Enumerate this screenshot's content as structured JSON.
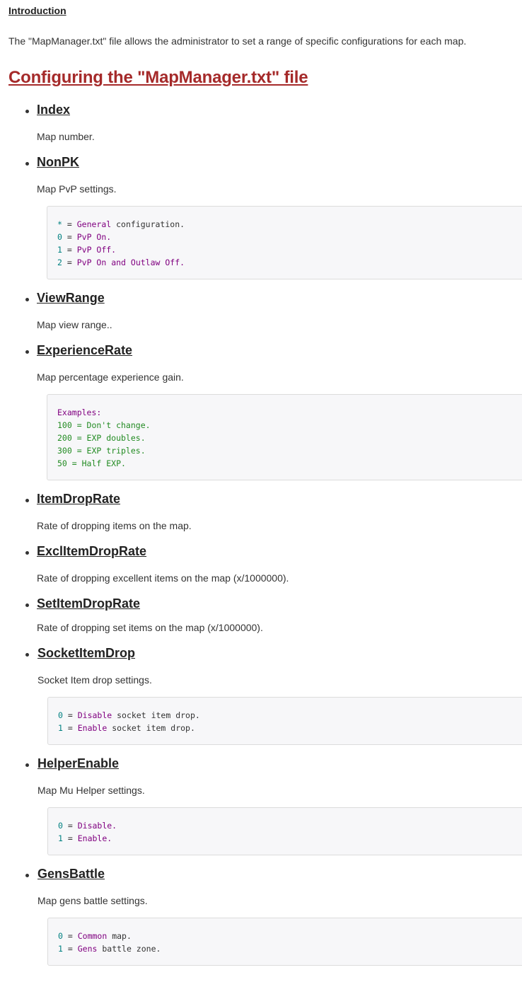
{
  "intro": {
    "heading": "Introduction",
    "text": "The \"MapManager.txt\" file allows the administrator to set a range of specific configurations for each map."
  },
  "title": "Configuring the \"MapManager.txt\" file",
  "items": [
    {
      "name": "Index",
      "desc": "Map number."
    },
    {
      "name": "NonPK",
      "desc": "Map PvP settings.",
      "code": [
        [
          [
            "*",
            "n"
          ],
          [
            " = ",
            "p"
          ],
          [
            "General",
            "k"
          ],
          [
            " configuration.",
            "p"
          ]
        ],
        [
          [
            "0",
            "n"
          ],
          [
            " = ",
            "p"
          ],
          [
            "PvP On.",
            "k"
          ]
        ],
        [
          [
            "1",
            "n"
          ],
          [
            " = ",
            "p"
          ],
          [
            "PvP Off.",
            "k"
          ]
        ],
        [
          [
            "2",
            "n"
          ],
          [
            " = ",
            "p"
          ],
          [
            "PvP On ",
            "k"
          ],
          [
            "and",
            "k"
          ],
          [
            " Outlaw Off.",
            "k"
          ]
        ]
      ]
    },
    {
      "name": "ViewRange",
      "desc": "Map view range.."
    },
    {
      "name": "ExperienceRate",
      "desc": "Map percentage experience gain.",
      "code": [
        [
          [
            "Examples:",
            "k"
          ]
        ],
        [
          [
            "100 = Don't change.",
            "g"
          ]
        ],
        [
          [
            "200 = EXP doubles.",
            "g"
          ]
        ],
        [
          [
            "300 = EXP triples.",
            "g"
          ]
        ],
        [
          [
            "50 = Half EXP.",
            "g"
          ]
        ]
      ]
    },
    {
      "name": "ItemDropRate",
      "desc": "Rate of dropping items on the map."
    },
    {
      "name": "ExclItemDropRate",
      "desc": "Rate of dropping excellent items on the map (x/1000000)."
    },
    {
      "name": "SetItemDropRate",
      "desc": "Rate of dropping set items on the map (x/1000000)."
    },
    {
      "name": "SocketItemDrop",
      "desc": "Socket Item drop settings.",
      "code": [
        [
          [
            "0",
            "n"
          ],
          [
            " = ",
            "p"
          ],
          [
            "Disable",
            "k"
          ],
          [
            " socket item drop.",
            "p"
          ]
        ],
        [
          [
            "1",
            "n"
          ],
          [
            " = ",
            "p"
          ],
          [
            "Enable",
            "k"
          ],
          [
            " socket item drop.",
            "p"
          ]
        ]
      ]
    },
    {
      "name": "HelperEnable",
      "desc": "Map Mu Helper settings.",
      "code": [
        [
          [
            "0",
            "n"
          ],
          [
            " = ",
            "p"
          ],
          [
            "Disable.",
            "k"
          ]
        ],
        [
          [
            "1",
            "n"
          ],
          [
            " = ",
            "p"
          ],
          [
            "Enable.",
            "k"
          ]
        ]
      ]
    },
    {
      "name": "GensBattle",
      "desc": "Map gens battle settings.",
      "code": [
        [
          [
            "0",
            "n"
          ],
          [
            " = ",
            "p"
          ],
          [
            "Common",
            "k"
          ],
          [
            " map.",
            "p"
          ]
        ],
        [
          [
            "1",
            "n"
          ],
          [
            " = ",
            "p"
          ],
          [
            "Gens",
            "k"
          ],
          [
            " battle zone.",
            "p"
          ]
        ]
      ]
    }
  ]
}
